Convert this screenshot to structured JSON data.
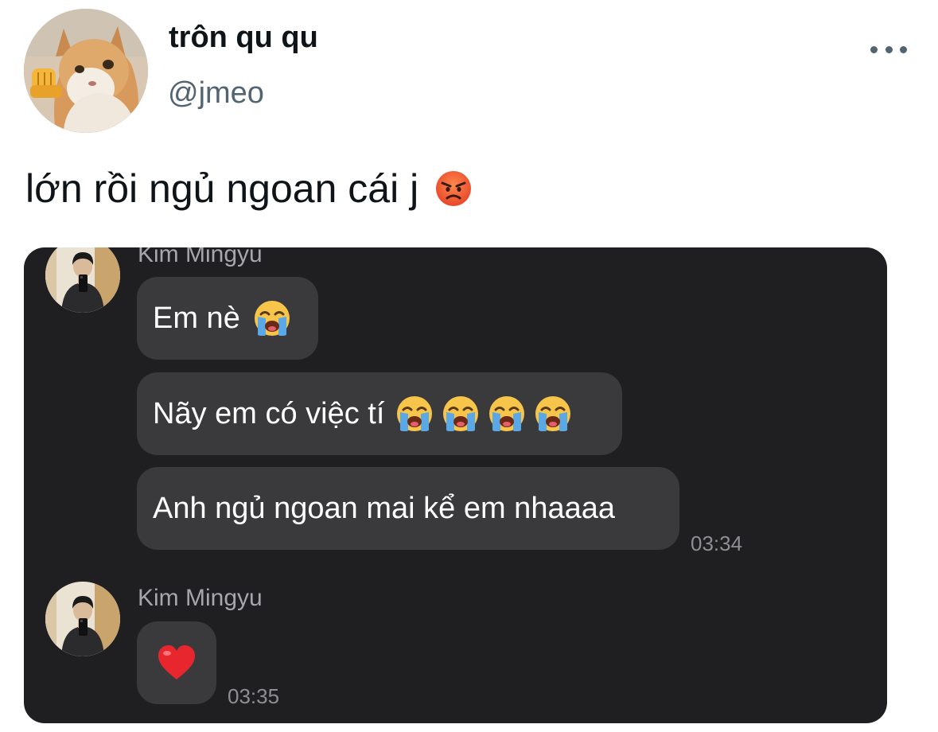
{
  "user": {
    "display_name": "trôn qu qu",
    "handle": "@jmeo"
  },
  "more_icon": "more-horizontal-icon",
  "tweet": {
    "text": "lớn rồi ngủ ngoan cái j",
    "emoji": "angry-face"
  },
  "chat": {
    "messages": [
      {
        "sender": "Kim Mingyu",
        "bubbles": [
          {
            "text": "Em nè",
            "emoji_count": 1,
            "emoji": "loudly-crying-face"
          },
          {
            "text": "Nãy em có việc tí",
            "emoji_count": 4,
            "emoji": "loudly-crying-face"
          },
          {
            "text": "Anh ngủ ngoan mai kể em nhaaaa",
            "emoji_count": 0
          }
        ],
        "time": "03:34"
      },
      {
        "sender": "Kim Mingyu",
        "bubbles": [
          {
            "text": "",
            "emoji": "red-heart"
          }
        ],
        "time": "03:35"
      }
    ]
  },
  "colors": {
    "chat_background": "#1f1f21",
    "bubble": "#3a3a3d",
    "handle_gray": "#536471"
  }
}
